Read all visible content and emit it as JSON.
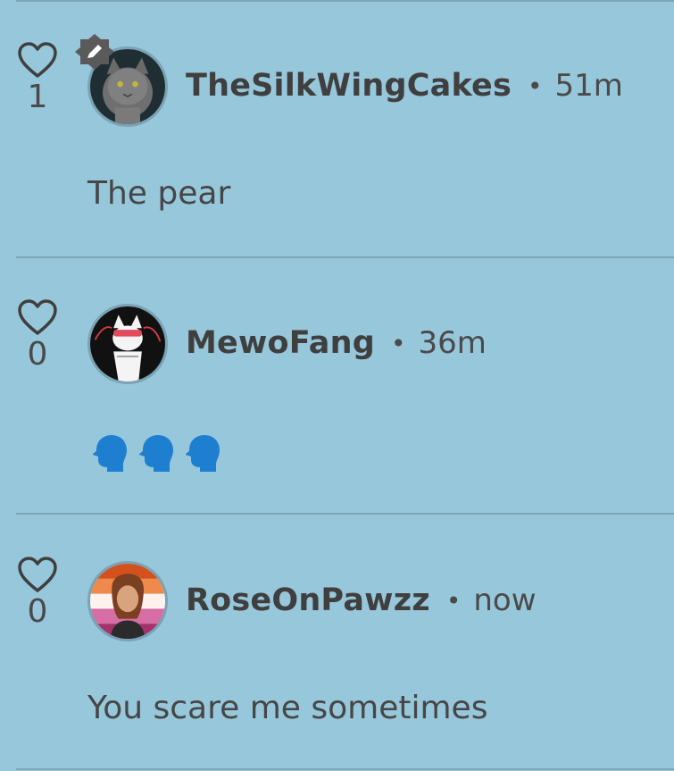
{
  "comments": [
    {
      "username": "TheSilkWingCakes",
      "separator": "•",
      "time": "51m",
      "likes": "1",
      "text": "The pear",
      "is_moderator": true,
      "avatar_icon": "gray-cat-avatar"
    },
    {
      "username": "MewoFang",
      "separator": "•",
      "time": "36m",
      "likes": "0",
      "text": "",
      "emojis": [
        "speaking-head-icon",
        "speaking-head-icon",
        "speaking-head-icon"
      ],
      "is_moderator": false,
      "avatar_icon": "white-cat-avatar"
    },
    {
      "username": "RoseOnPawzz",
      "separator": "•",
      "time": "now",
      "likes": "0",
      "text": "You scare me sometimes",
      "is_moderator": false,
      "avatar_icon": "person-pride-avatar"
    }
  ],
  "colors": {
    "background": "#97c7da",
    "divider": "#7ea7b7",
    "text": "#3f3f3f",
    "emoji_blue": "#1e7fd1"
  }
}
